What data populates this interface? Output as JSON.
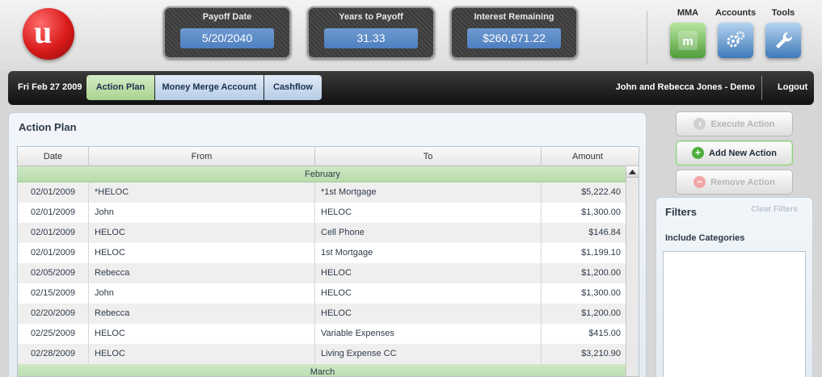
{
  "header": {
    "logo_letter": "u",
    "stats": [
      {
        "label": "Payoff Date",
        "value": "5/20/2040"
      },
      {
        "label": "Years to Payoff",
        "value": "31.33"
      },
      {
        "label": "Interest Remaining",
        "value": "$260,671.22"
      }
    ],
    "tools": [
      {
        "label": "MMA",
        "icon": "mma-icon"
      },
      {
        "label": "Accounts",
        "icon": "gears-icon"
      },
      {
        "label": "Tools",
        "icon": "wrench-icon"
      }
    ]
  },
  "nav": {
    "date": "Fri Feb 27 2009",
    "tabs": [
      "Action Plan",
      "Money Merge Account",
      "Cashflow"
    ],
    "active_tab": "Action Plan",
    "user": "John and Rebecca Jones - Demo",
    "logout": "Logout"
  },
  "panel": {
    "title": "Action Plan",
    "columns": [
      "Date",
      "From",
      "To",
      "Amount"
    ],
    "groups": [
      {
        "name": "February",
        "rows": [
          {
            "date": "02/01/2009",
            "from": "*HELOC",
            "to": "*1st Mortgage",
            "amount": "$5,222.40"
          },
          {
            "date": "02/01/2009",
            "from": "John",
            "to": "HELOC",
            "amount": "$1,300.00"
          },
          {
            "date": "02/01/2009",
            "from": "HELOC",
            "to": "Cell Phone",
            "amount": "$146.84"
          },
          {
            "date": "02/01/2009",
            "from": "HELOC",
            "to": "1st Mortgage",
            "amount": "$1,199.10"
          },
          {
            "date": "02/05/2009",
            "from": "Rebecca",
            "to": "HELOC",
            "amount": "$1,200.00"
          },
          {
            "date": "02/15/2009",
            "from": "John",
            "to": "HELOC",
            "amount": "$1,300.00"
          },
          {
            "date": "02/20/2009",
            "from": "Rebecca",
            "to": "HELOC",
            "amount": "$1,200.00"
          },
          {
            "date": "02/25/2009",
            "from": "HELOC",
            "to": "Variable Expenses",
            "amount": "$415.00"
          },
          {
            "date": "02/28/2009",
            "from": "HELOC",
            "to": "Living Expense CC",
            "amount": "$3,210.90"
          }
        ]
      },
      {
        "name": "March",
        "rows": []
      }
    ]
  },
  "actions": {
    "execute": "Execute Action",
    "add": "Add New Action",
    "remove": "Remove Action"
  },
  "filters": {
    "title": "Filters",
    "clear": "Clear Filters",
    "include": "Include Categories"
  },
  "colors": {
    "accent_blue": "#5b8ac8",
    "active_tab_green": "#a9d38f",
    "logo_red": "#d91a1a"
  }
}
